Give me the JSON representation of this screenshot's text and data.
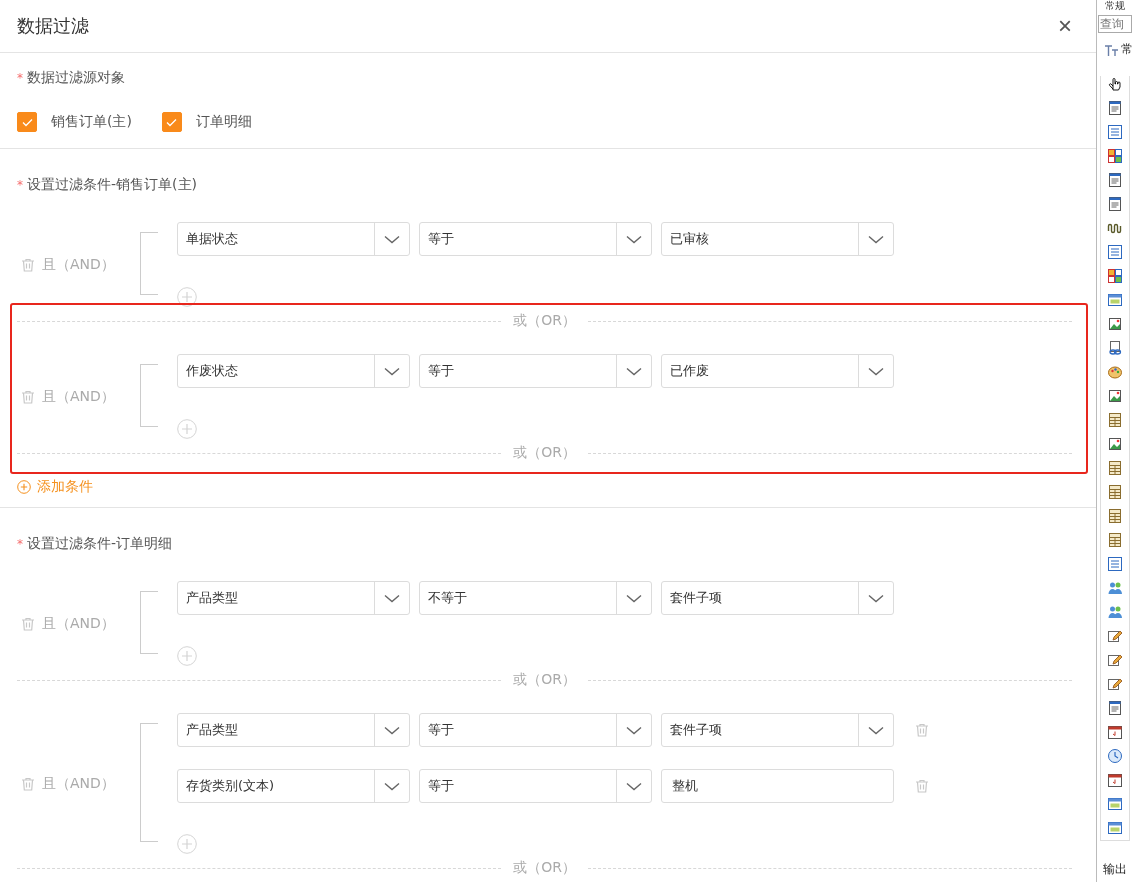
{
  "dialog": {
    "title": "数据过滤",
    "close_label": "×"
  },
  "source": {
    "required_mark": "*",
    "label": "数据过滤源对象",
    "options": [
      {
        "label": "销售订单(主)",
        "checked": true
      },
      {
        "label": "订单明细",
        "checked": true
      }
    ]
  },
  "sections": [
    {
      "required_mark": "*",
      "label": "设置过滤条件-销售订单(主)",
      "add_label": "添加条件",
      "groups": [
        {
          "connector": "且（AND）",
          "highlighted": false,
          "or_label": "或（OR）",
          "conditions": [
            {
              "field": "单据状态",
              "operator": "等于",
              "value": "已审核",
              "kind": "select",
              "removable": false
            }
          ]
        },
        {
          "connector": "且（AND）",
          "highlighted": true,
          "or_label": "或（OR）",
          "conditions": [
            {
              "field": "作废状态",
              "operator": "等于",
              "value": "已作废",
              "kind": "select",
              "removable": false
            }
          ]
        }
      ]
    },
    {
      "required_mark": "*",
      "label": "设置过滤条件-订单明细",
      "groups": [
        {
          "connector": "且（AND）",
          "highlighted": false,
          "or_label": "或（OR）",
          "conditions": [
            {
              "field": "产品类型",
              "operator": "不等于",
              "value": "套件子项",
              "kind": "select",
              "removable": false
            }
          ]
        },
        {
          "connector": "且（AND）",
          "highlighted": false,
          "or_label": "或（OR）",
          "conditions": [
            {
              "field": "产品类型",
              "operator": "等于",
              "value": "套件子项",
              "kind": "select",
              "removable": true
            },
            {
              "field": "存货类别(文本)",
              "operator": "等于",
              "value": "整机",
              "kind": "input",
              "removable": true
            }
          ]
        }
      ]
    }
  ],
  "toolbox": {
    "header": "常规",
    "search_placeholder": "查询",
    "first_item": "常",
    "footer": "输出",
    "tools": [
      {
        "kind": "cursor"
      },
      {
        "kind": "document"
      },
      {
        "kind": "list"
      },
      {
        "kind": "grid"
      },
      {
        "kind": "document"
      },
      {
        "kind": "document"
      },
      {
        "kind": "coil"
      },
      {
        "kind": "list"
      },
      {
        "kind": "grid"
      },
      {
        "kind": "window"
      },
      {
        "kind": "image"
      },
      {
        "kind": "link"
      },
      {
        "kind": "palette"
      },
      {
        "kind": "image"
      },
      {
        "kind": "table"
      },
      {
        "kind": "image"
      },
      {
        "kind": "table"
      },
      {
        "kind": "table"
      },
      {
        "kind": "table"
      },
      {
        "kind": "table"
      },
      {
        "kind": "list"
      },
      {
        "kind": "people"
      },
      {
        "kind": "people"
      },
      {
        "kind": "pencil"
      },
      {
        "kind": "pencil"
      },
      {
        "kind": "pencil"
      },
      {
        "kind": "document"
      },
      {
        "kind": "calendar"
      },
      {
        "kind": "clock"
      },
      {
        "kind": "calendar"
      },
      {
        "kind": "window"
      },
      {
        "kind": "window"
      }
    ]
  }
}
